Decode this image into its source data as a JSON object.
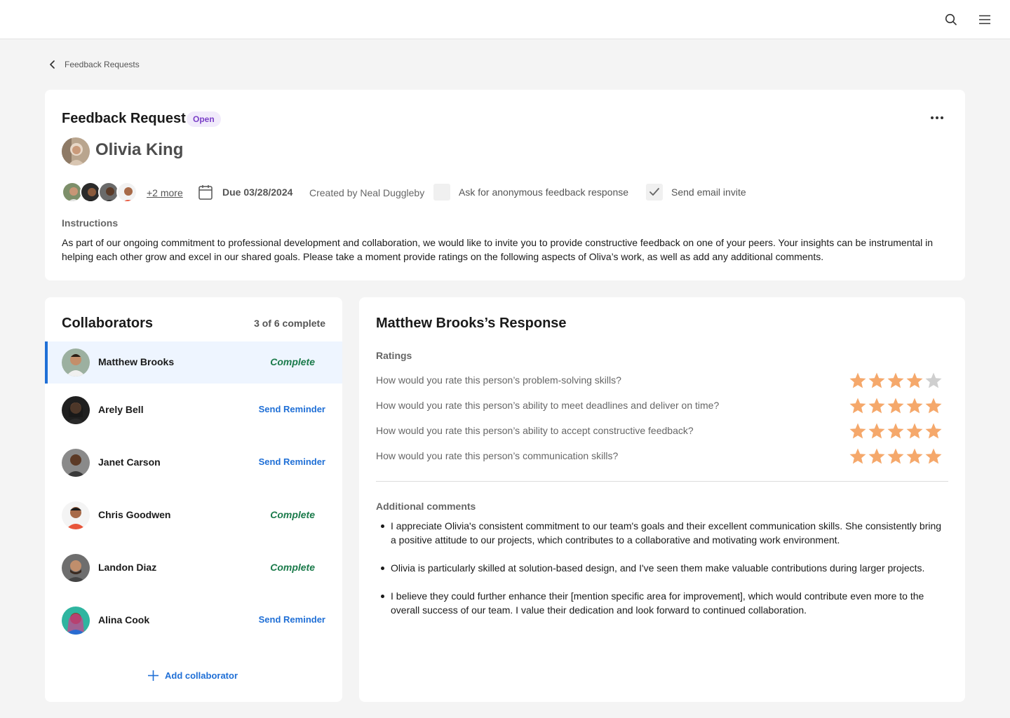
{
  "breadcrumb": {
    "label": "Feedback Requests"
  },
  "request": {
    "title": "Feedback Request",
    "status": "Open",
    "subject_name": "Olivia King",
    "more_collaborators": "+2 more",
    "due": "Due 03/28/2024",
    "created_by": "Created by Neal Duggleby",
    "anonymous_label": "Ask for anonymous feedback response",
    "email_label": "Send email invite",
    "instructions_label": "Instructions",
    "instructions_text": "As part of our ongoing commitment to professional development and collaboration, we would like to invite you to provide constructive feedback on one of your peers. Your insights can be instrumental in helping each other grow and excel in our shared goals. Please take a moment provide ratings on the following aspects of Oliva’s work, as well as add any additional comments."
  },
  "collaborators": {
    "title": "Collaborators",
    "count": "3 of 6 complete",
    "items": [
      {
        "name": "Matthew Brooks",
        "status": "Complete"
      },
      {
        "name": "Arely Bell",
        "status": "Send Reminder"
      },
      {
        "name": "Janet Carson",
        "status": "Send Reminder"
      },
      {
        "name": "Chris Goodwen",
        "status": "Complete"
      },
      {
        "name": "Landon Diaz",
        "status": "Complete"
      },
      {
        "name": "Alina Cook",
        "status": "Send Reminder"
      }
    ],
    "add_label": "Add collaborator"
  },
  "response": {
    "title": "Matthew Brooks’s Response",
    "ratings_label": "Ratings",
    "ratings": [
      {
        "question": "How would you rate this person’s problem-solving skills?",
        "stars": 4
      },
      {
        "question": "How would you rate this person’s ability to meet deadlines and deliver on time?",
        "stars": 5
      },
      {
        "question": "How would you rate this person’s ability to accept constructive feedback?",
        "stars": 5
      },
      {
        "question": "How would you rate this person’s communication skills?",
        "stars": 5
      }
    ],
    "comments_label": "Additional comments",
    "comments": [
      "I appreciate Olivia's consistent commitment to our team's goals and their excellent communication skills. She consistently bring a positive attitude to our projects, which contributes to a collaborative and motivating work environment.",
      "Olivia is particularly skilled at solution-based design, and I've seen them make valuable contributions during larger projects.",
      "I believe they could further enhance their [mention specific area for improvement], which would contribute even more to the overall success of our team. I value their dedication and look forward to continued collaboration."
    ]
  },
  "colors": {
    "star_filled": "#f5a86b",
    "star_empty": "#cfcfcf",
    "link_blue": "#1f6fd6",
    "complete_green": "#1a7a4a",
    "open_badge_text": "#7a3fc7",
    "open_badge_bg": "#f1ebfb"
  },
  "icons": {
    "search": "search-icon",
    "menu": "hamburger-menu-icon",
    "back": "chevron-left-icon",
    "more": "more-horizontal-icon",
    "calendar": "calendar-icon",
    "check": "checkmark-icon",
    "add": "plus-icon",
    "star": "star-icon"
  }
}
